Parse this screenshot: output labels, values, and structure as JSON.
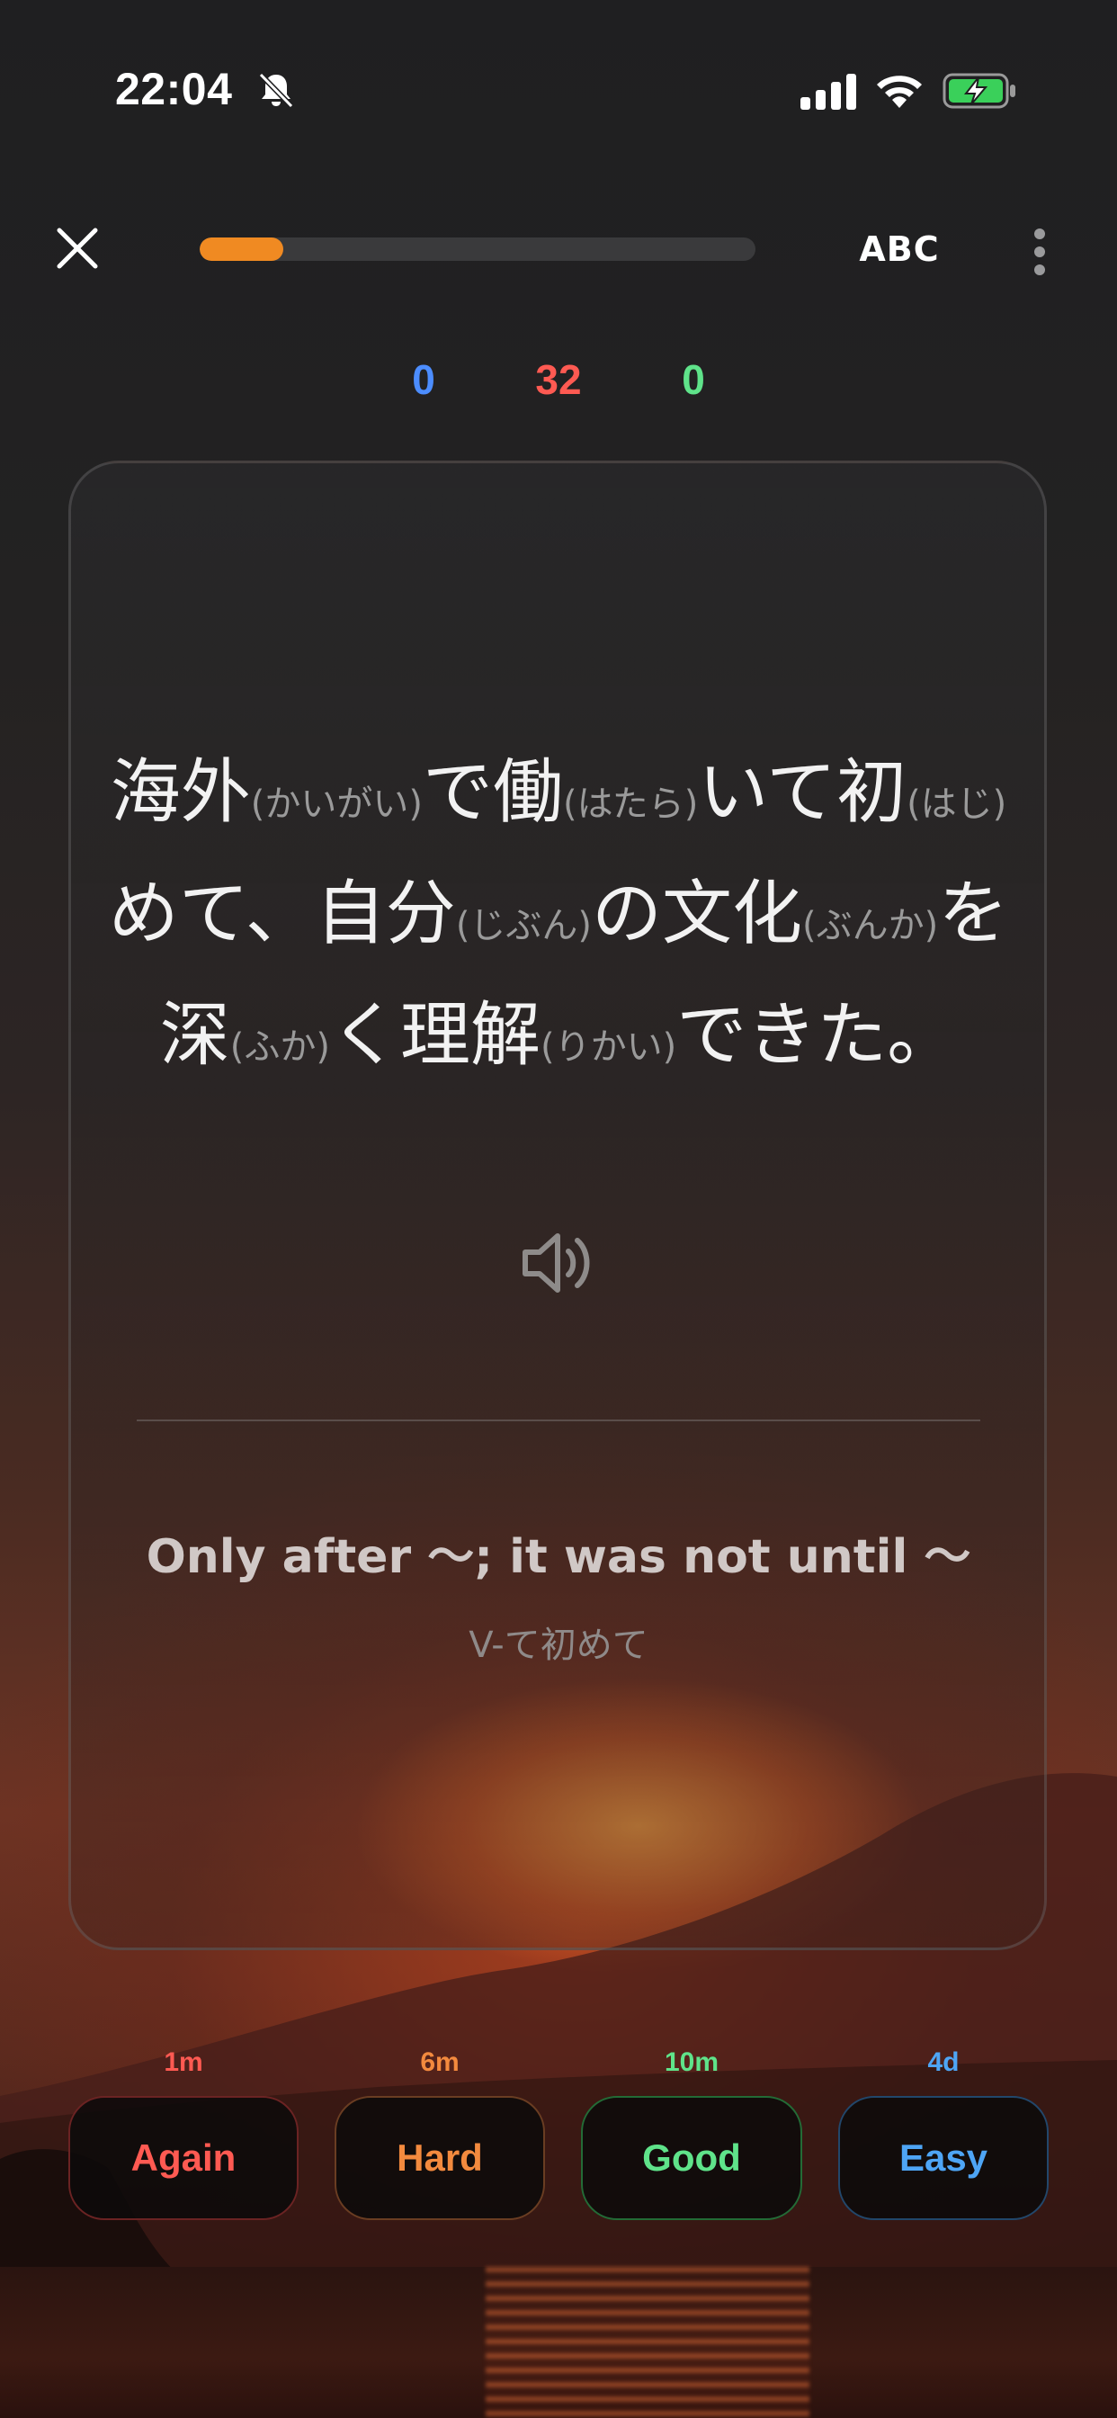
{
  "status_bar": {
    "time": "22:04"
  },
  "top_bar": {
    "progress_fraction": 0.15,
    "abc_label": "ABC"
  },
  "counts": {
    "new": "0",
    "learning": "32",
    "review": "0"
  },
  "card": {
    "sentence": [
      {
        "t": "海外"
      },
      {
        "r": "(かいがい)"
      },
      {
        "t": "で働"
      },
      {
        "r": "(はたら)"
      },
      {
        "t": "いて初"
      },
      {
        "r": "(はじ)"
      },
      {
        "t": "めて、自分"
      },
      {
        "r": "(じぶん)"
      },
      {
        "t": "の文化"
      },
      {
        "r": "(ぶんか)"
      },
      {
        "t": "を深"
      },
      {
        "r": "(ふか)"
      },
      {
        "t": "く理解"
      },
      {
        "r": "(りかい)"
      },
      {
        "t": "できた。"
      }
    ],
    "meaning": "Only after 〜; it was not until 〜",
    "pattern": "V-て初めて"
  },
  "answers": {
    "again": {
      "label": "Again",
      "interval": "1m"
    },
    "hard": {
      "label": "Hard",
      "interval": "6m"
    },
    "good": {
      "label": "Good",
      "interval": "10m"
    },
    "easy": {
      "label": "Easy",
      "interval": "4d"
    }
  },
  "colors": {
    "accent": "#f08a22",
    "new": "#4c8dff",
    "learning": "#ff5a52",
    "review": "#5fe38a"
  }
}
